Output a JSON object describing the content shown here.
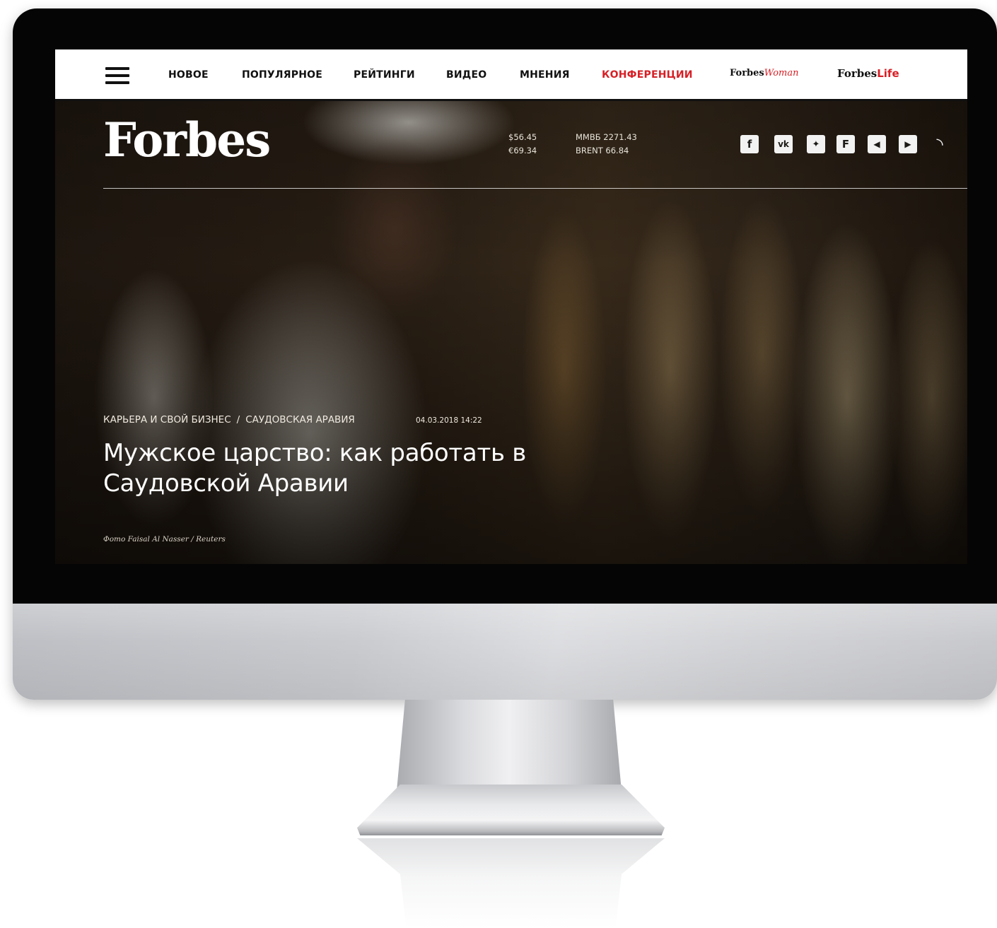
{
  "nav": {
    "items": [
      {
        "label": "НОВОЕ",
        "color": "#111111"
      },
      {
        "label": "ПОПУЛЯРНОЕ",
        "color": "#111111"
      },
      {
        "label": "РЕЙТИНГИ",
        "color": "#111111"
      },
      {
        "label": "ВИДЕО",
        "color": "#111111"
      },
      {
        "label": "МНЕНИЯ",
        "color": "#111111"
      },
      {
        "label": "КОНФЕРЕНЦИИ",
        "color": "#d71f26"
      }
    ],
    "forbes_woman": {
      "prefix": "Forbes",
      "accent": "Woman"
    },
    "forbes_life": {
      "prefix": "Forbes",
      "accent": "Life"
    }
  },
  "header": {
    "logo": "Forbes",
    "ticker": {
      "usd": "$56.45",
      "eur": "€69.34",
      "micex": "ММВБ 2271.43",
      "brent": "BRENT 66.84"
    },
    "social_icons": [
      "facebook-icon",
      "vk-icon",
      "twitter-icon",
      "flipboard-icon",
      "telegram-icon",
      "youtube-icon",
      "rss-icon"
    ],
    "social_glyphs": {
      "facebook": "f",
      "vk": "vk",
      "twitter": "✦",
      "flipboard": "F",
      "telegram": "◀",
      "youtube": "▶",
      "rss": "◝"
    }
  },
  "article": {
    "category": "КАРЬЕРА И СВОЙ БИЗНЕС",
    "separator": "/",
    "tag": "САУДОВСКАЯ АРАВИЯ",
    "date": "04.03.2018 14:22",
    "headline": "Мужское царство: как работать в Саудовской Аравии",
    "photo_credit": "Фото Faisal Al Nasser / Reuters"
  },
  "colors": {
    "accent_red": "#d71f26",
    "nav_text": "#111111"
  }
}
